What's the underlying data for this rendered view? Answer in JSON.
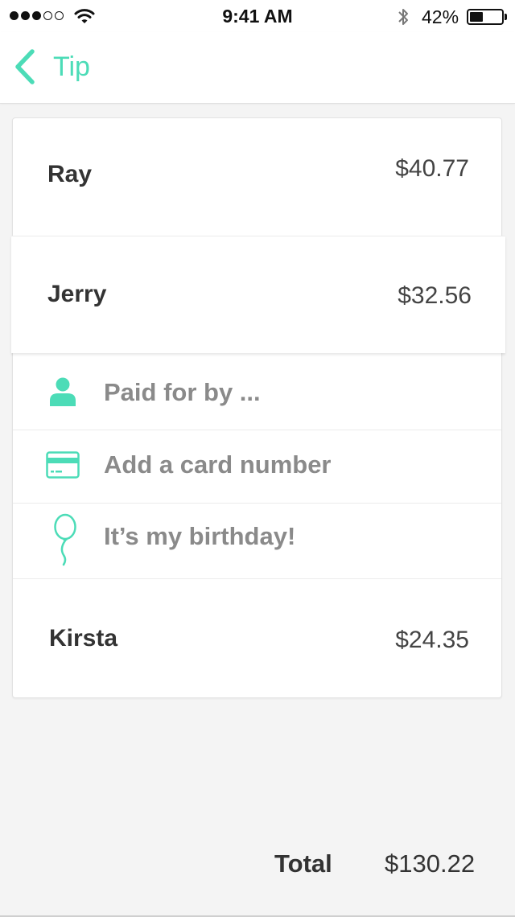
{
  "status_bar": {
    "time": "9:41 AM",
    "battery_percent": "42%",
    "battery_level": 0.42,
    "signal_bars_filled": 3,
    "signal_bars_total": 5
  },
  "nav": {
    "back_label": "Tip"
  },
  "people": [
    {
      "name": "Ray",
      "amount": "$40.77"
    },
    {
      "name": "Jerry",
      "amount": "$32.56"
    },
    {
      "name": "Kirsta",
      "amount": "$24.35"
    }
  ],
  "options": {
    "paid_for_by": "Paid for by ...",
    "add_card": "Add a card number",
    "birthday": "It’s my birthday!"
  },
  "total": {
    "label": "Total",
    "amount": "$130.22"
  },
  "colors": {
    "accent": "#4cdcb7",
    "background": "#f4f4f4",
    "text": "#333333",
    "option_text": "#8a8a8a"
  },
  "icons": {
    "back": "chevron-left-icon",
    "person": "person-icon",
    "card": "credit-card-icon",
    "balloon": "balloon-icon",
    "wifi": "wifi-icon",
    "bluetooth": "bluetooth-icon"
  }
}
